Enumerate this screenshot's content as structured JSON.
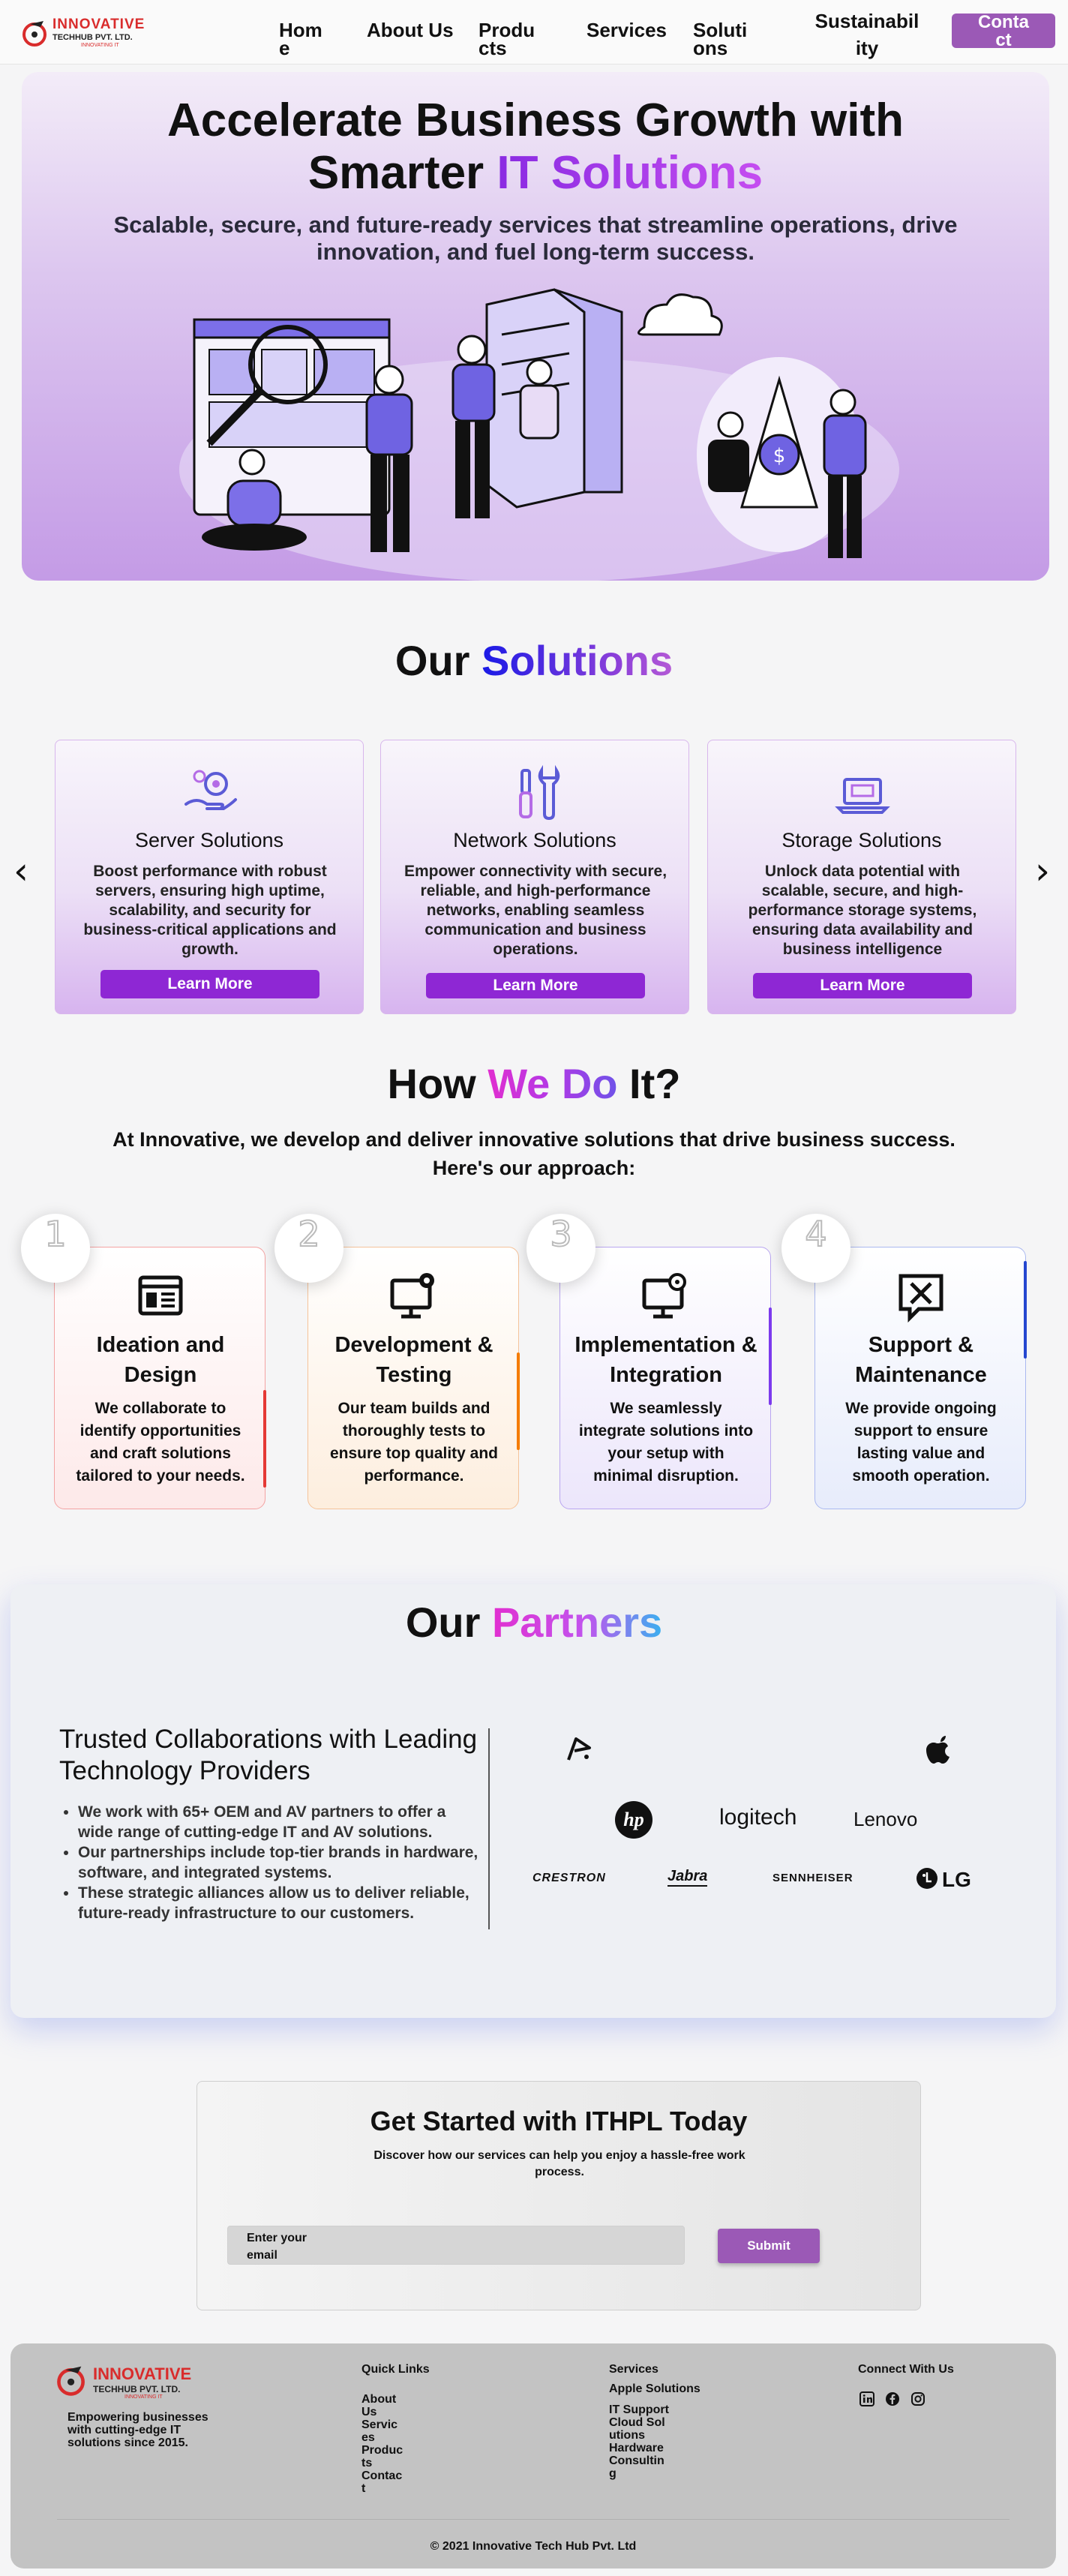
{
  "nav": {
    "logo_text": "INNOVATIVE",
    "logo_sub": "TECHHUB PVT. LTD.",
    "logo_tag": "INNOVATING IT",
    "items": [
      "Home",
      "About Us",
      "Products",
      "Services",
      "Solutions",
      "Sustainability"
    ],
    "contact": "Contact"
  },
  "hero": {
    "title_line1": "Accelerate Business Growth with",
    "title_line2_plain": "Smarter ",
    "title_line2_accent": "IT Solutions",
    "subtitle": "Scalable, secure, and future-ready services that streamline operations, drive innovation, and fuel long-term success."
  },
  "solutions": {
    "title_plain": "Our ",
    "title_accent": "Solutions",
    "cards": [
      {
        "icon": "hand-gear-icon",
        "title": "Server Solutions",
        "text": "Boost performance with robust servers, ensuring high uptime, scalability, and security for business-critical applications and growth.",
        "button": "Learn More"
      },
      {
        "icon": "tools-icon",
        "title": "Network Solutions",
        "text": "Empower connectivity with secure, reliable, and high-performance networks, enabling seamless communication and business operations.",
        "button": "Learn More"
      },
      {
        "icon": "laptop-icon",
        "title": "Storage Solutions",
        "text": "Unlock data potential with scalable, secure, and high-performance storage systems, ensuring data availability and business intelligence",
        "button": "Learn More"
      }
    ],
    "prev": "‹",
    "next": "›"
  },
  "how": {
    "title_plain1": "How ",
    "title_accent": "We Do",
    "title_plain2": " It?",
    "subtitle": "At Innovative, we develop and deliver innovative solutions that drive business success. Here's our approach:",
    "steps": [
      {
        "num": "1",
        "title": "Ideation and Design",
        "text": "We collaborate to identify opportunities and craft solutions tailored to your needs.",
        "color": "#e53935"
      },
      {
        "num": "2",
        "title": "Development & Testing",
        "text": "Our team builds and thoroughly tests to ensure top quality and performance.",
        "color": "#f57c00"
      },
      {
        "num": "3",
        "title": "Implementation & Integration",
        "text": "We seamlessly integrate solutions into your setup with minimal disruption.",
        "color": "#7c3aed"
      },
      {
        "num": "4",
        "title": "Support & Maintenance",
        "text": "We provide ongoing support to ensure lasting value and smooth operation.",
        "color": "#2547d0"
      }
    ]
  },
  "partners": {
    "title_plain": "Our ",
    "title_accent": "Partners",
    "heading": "Trusted Collaborations with Leading Technology Providers",
    "bullets": [
      "We work with 65+ OEM and AV partners to offer a wide range of cutting-edge IT and AV solutions.",
      "Our partnerships include top-tier brands in hardware, software, and integrated systems.",
      "These strategic alliances allow us to deliver reliable, future-ready infrastructure to our customers."
    ],
    "brands": [
      "hp",
      "logitech",
      "Lenovo",
      "CRESTRON",
      "Jabra",
      "SENNHEISER",
      "LG"
    ]
  },
  "cta": {
    "title": "Get Started with ITHPL Today",
    "text": "Discover how our services can help you enjoy a hassle-free work process.",
    "placeholder": "Enter your email",
    "submit": "Submit"
  },
  "footer": {
    "tagline": "Empowering businesses with cutting-edge IT solutions since 2015.",
    "quick_title": "Quick Links",
    "quick_links": [
      "About Us",
      "Services",
      "Products",
      "Contact"
    ],
    "services_title": "Services",
    "services": [
      "Apple Solutions",
      "IT Support",
      "Cloud Solutions",
      "Hardware",
      "Consulting"
    ],
    "connect_title": "Connect With Us",
    "copyright": "© 2021 Innovative Tech Hub Pvt. Ltd"
  }
}
